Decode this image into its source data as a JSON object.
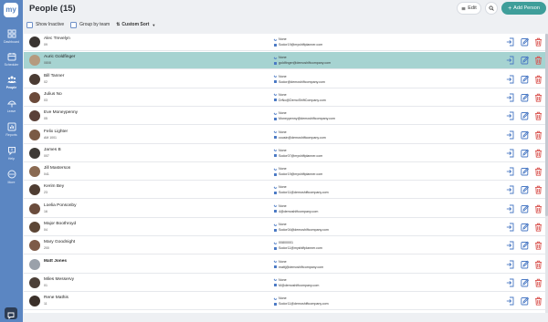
{
  "app": {
    "logo": "my"
  },
  "sidebar": {
    "items": [
      {
        "label": "Dashboard",
        "icon": "grid-icon"
      },
      {
        "label": "Scheduler",
        "icon": "calendar-icon"
      },
      {
        "label": "People",
        "icon": "people-icon",
        "active": true
      },
      {
        "label": "Leave",
        "icon": "leave-icon"
      },
      {
        "label": "Reports",
        "icon": "reports-icon"
      },
      {
        "label": "Help",
        "icon": "help-icon"
      },
      {
        "label": "More",
        "icon": "more-icon"
      }
    ]
  },
  "header": {
    "title": "People (15)",
    "edit_label": "Edit",
    "add_label": "Add Person"
  },
  "toolbar": {
    "show_inactive": "Show Inactive",
    "group_by_team": "Group by team",
    "custom_sort": "Custom Sort"
  },
  "people": [
    {
      "name": "Alec Trevelyn",
      "code": "09",
      "contact1": "None",
      "contact2": "Sodor19@myshiftplanner.com",
      "avatar": "#3a3430"
    },
    {
      "name": "Auric Goldfinger",
      "code": "0808",
      "contact1": "None",
      "contact2": "goldfinger@demoshiftcompany.com",
      "avatar": "#b59a7e",
      "selected": true
    },
    {
      "name": "Bill Tanner",
      "code": "02",
      "contact1": "None",
      "contact2": "Sodor@demoshiftcompany.com",
      "avatar": "#4a3b33"
    },
    {
      "name": "Julius No",
      "code": "03",
      "contact1": "None",
      "contact2": "DrNo@DemoShiftCompany.com",
      "avatar": "#6b4a3a"
    },
    {
      "name": "Eve Moneypenny",
      "code": "05",
      "contact1": "None",
      "contact2": "Moneypenny@demoshiftcompany.com",
      "avatar": "#5a4038"
    },
    {
      "name": "Felix Lighter",
      "code": "AM 1001",
      "contact1": "None",
      "contact2": "cousin@demoshiftcompany.com",
      "avatar": "#7a5a45"
    },
    {
      "name": "James B",
      "code": "007",
      "contact1": "None",
      "contact2": "Sodor07@myshiftplanner.com",
      "avatar": "#3e3a36"
    },
    {
      "name": "Jill Masterson",
      "code": "041",
      "contact1": "None",
      "contact2": "Sodor19@myshiftplanner.com",
      "avatar": "#8a6a52"
    },
    {
      "name": "Kerim Bey",
      "code": "23",
      "contact1": "None",
      "contact2": "Sodor11@demoshiftcompany.com",
      "avatar": "#4f3d32"
    },
    {
      "name": "Loelia Ponsonby",
      "code": "16",
      "contact1": "None",
      "contact2": "4@demoshiftcompany.com",
      "avatar": "#6a4c3c"
    },
    {
      "name": "Major Boothroyd",
      "code": "04",
      "contact1": "None",
      "contact2": "Sodor04@demoshiftcompany.com",
      "avatar": "#5c4636"
    },
    {
      "name": "Mary Goodnight",
      "code": "200",
      "contact1": "00800001",
      "contact2": "Sodor11@myshiftplanner.com",
      "avatar": "#7d5a48"
    },
    {
      "name": "Matt Jones",
      "code": "",
      "contact1": "None",
      "contact2": "mattj@demoshiftcompany.com",
      "avatar": "#9aa1aa",
      "bold": true
    },
    {
      "name": "Miles Messervy",
      "code": "01",
      "contact1": "None",
      "contact2": "M@demoshiftcompany.com",
      "avatar": "#4c4038"
    },
    {
      "name": "Rene Mathis",
      "code": "11",
      "contact1": "None",
      "contact2": "Sodor11@demoshiftcompany.com",
      "avatar": "#3b302a"
    }
  ],
  "colors": {
    "sidebar": "#5b86c2",
    "accent": "#3f9e9a",
    "selected_row": "#a6d3d1",
    "action_blue": "#4a79c4",
    "delete_red": "#d9534f"
  }
}
